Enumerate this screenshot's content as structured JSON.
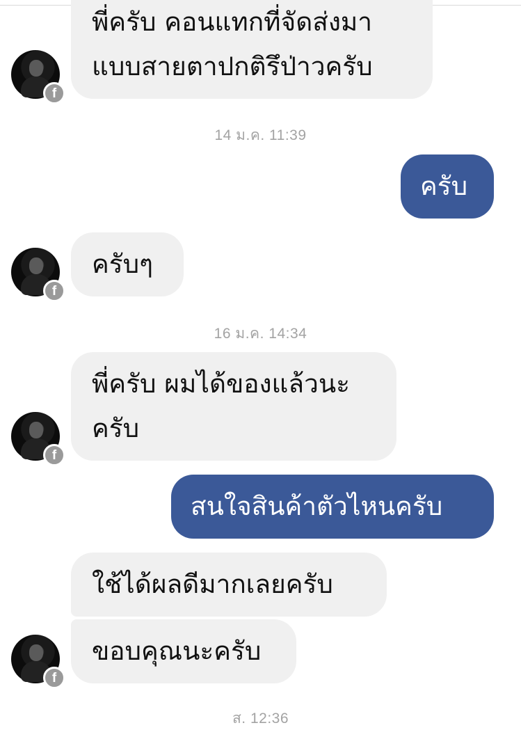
{
  "messages": {
    "m1": "พี่ครับ คอนแทกที่จัดส่งมา",
    "m1b": "แบบสายตาปกติรึป่าวครับ",
    "m2": "ครับ",
    "m3": "ครับๆ",
    "m4": "พี่ครับ ผมได้ของแล้วนะ",
    "m4b": "ครับ",
    "m5": "สนใจสินค้าตัวไหนครับ",
    "m6": "ใช้ได้ผลดีมากเลยครับ",
    "m7": "ขอบคุณนะครับ"
  },
  "timestamps": {
    "t1": "14 ม.ค. 11:39",
    "t2": "16 ม.ค. 14:34",
    "t3": "ส. 12:36"
  },
  "icons": {
    "avatar": "user-avatar",
    "badge": "facebook-icon",
    "badge_glyph": "f"
  },
  "colors": {
    "outgoing_bubble": "#3b5998",
    "incoming_bubble": "#f0f0f0",
    "timestamp": "#a3a3a3"
  }
}
